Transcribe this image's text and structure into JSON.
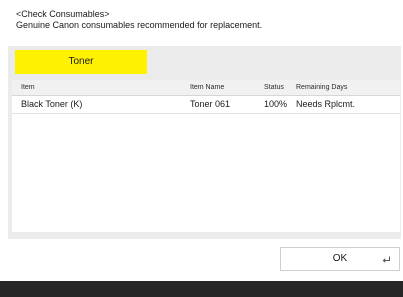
{
  "header": {
    "title": "<Check Consumables>",
    "subtitle": "Genuine Canon consumables recommended for replacement."
  },
  "tabs": [
    {
      "label": "Toner",
      "active": true
    }
  ],
  "table": {
    "columns": [
      "Item",
      "Item Name",
      "Status",
      "Remaining Days"
    ],
    "rows": [
      {
        "item": "Black Toner (K)",
        "item_name": "Toner 061",
        "status": "100%",
        "remaining_days": "Needs Rplcmt."
      }
    ]
  },
  "ok_button": {
    "label": "OK",
    "icon": "enter-icon"
  },
  "colors": {
    "tab_active": "#fff200",
    "panel_bg": "#ebebeb",
    "footer_bar": "#262626"
  }
}
